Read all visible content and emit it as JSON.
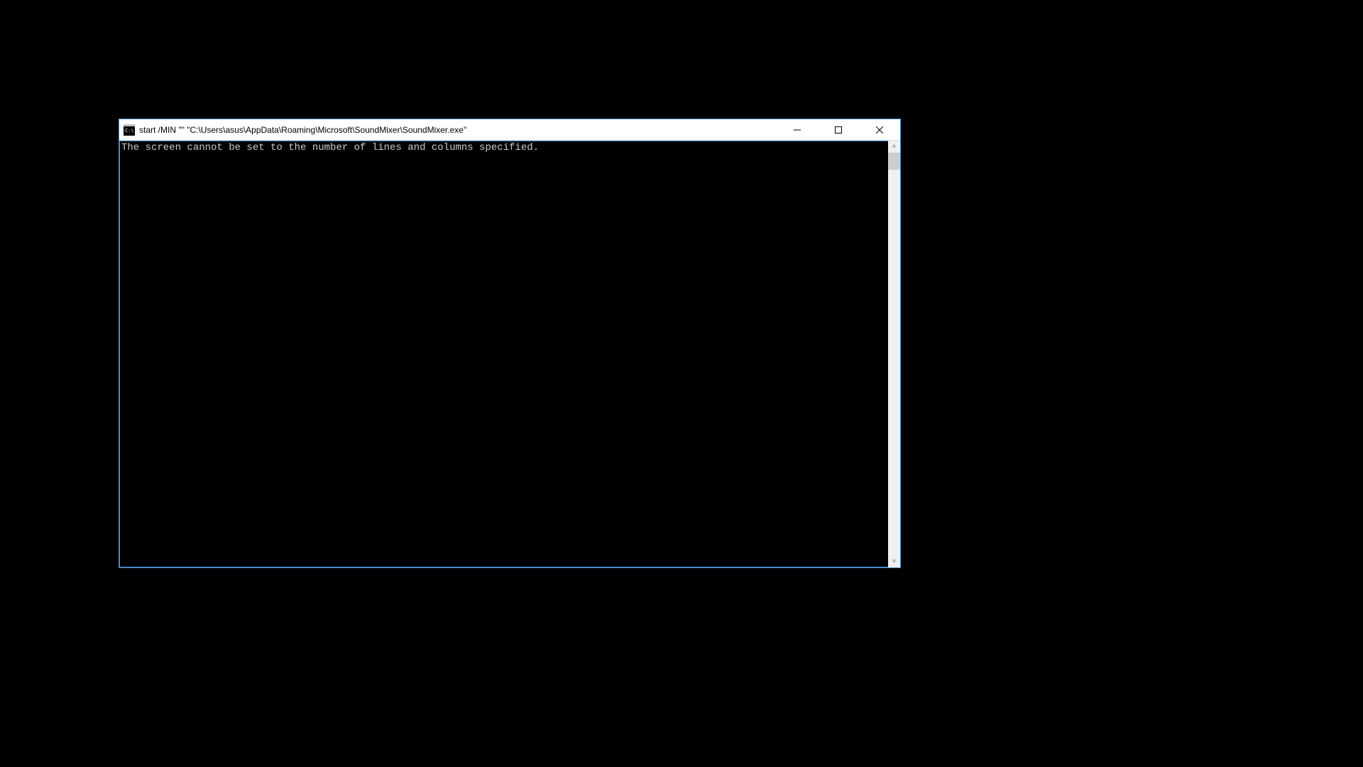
{
  "window": {
    "title": "start  /MIN \"\" \"C:\\Users\\asus\\AppData\\Roaming\\Microsoft\\SoundMixer\\SoundMixer.exe\"",
    "icon_name": "cmd-icon"
  },
  "console": {
    "output": "The screen cannot be set to the number of lines and columns specified."
  },
  "scrollbar": {
    "arrow_up": "˄",
    "arrow_down": "˅"
  }
}
